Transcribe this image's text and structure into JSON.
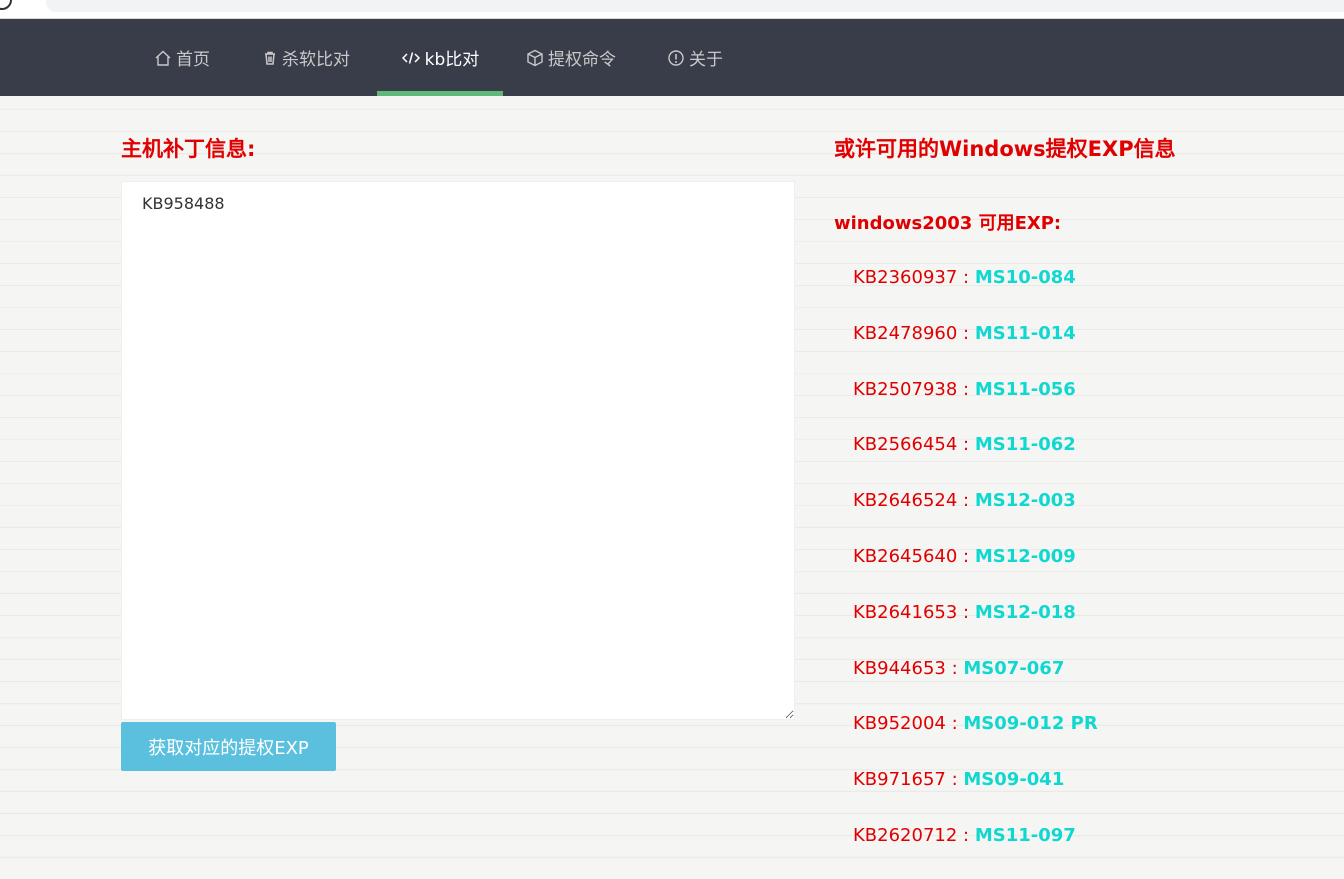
{
  "nav": {
    "items": [
      {
        "label": "首页",
        "icon": "home-icon"
      },
      {
        "label": "杀软比对",
        "icon": "trash-icon"
      },
      {
        "label": "kb比对",
        "icon": "code-icon"
      },
      {
        "label": "提权命令",
        "icon": "cube-icon"
      },
      {
        "label": "关于",
        "icon": "info-icon"
      }
    ],
    "active": "kb比对",
    "active_color": "#5fb878",
    "bg_color": "#393d49"
  },
  "left": {
    "title": "主机补丁信息:",
    "textarea_value": "KB958488",
    "button_label": "获取对应的提权EXP"
  },
  "right": {
    "title": "或许可用的Windows提权EXP信息",
    "os_title": "windows2003 可用EXP:",
    "separator": " : ",
    "items": [
      {
        "kb": "KB2360937",
        "ms": "MS10-084"
      },
      {
        "kb": "KB2478960",
        "ms": "MS11-014"
      },
      {
        "kb": "KB2507938",
        "ms": "MS11-056"
      },
      {
        "kb": "KB2566454",
        "ms": "MS11-062"
      },
      {
        "kb": "KB2646524",
        "ms": "MS12-003"
      },
      {
        "kb": "KB2645640",
        "ms": "MS12-009"
      },
      {
        "kb": "KB2641653",
        "ms": "MS12-018"
      },
      {
        "kb": "KB944653",
        "ms": "MS07-067"
      },
      {
        "kb": "KB952004",
        "ms": "MS09-012 PR"
      },
      {
        "kb": "KB971657",
        "ms": "MS09-041"
      },
      {
        "kb": "KB2620712",
        "ms": "MS11-097"
      }
    ]
  },
  "colors": {
    "title_red": "#e00000",
    "ms_cyan": "#10d8d0",
    "button_blue": "#5bc0de"
  }
}
